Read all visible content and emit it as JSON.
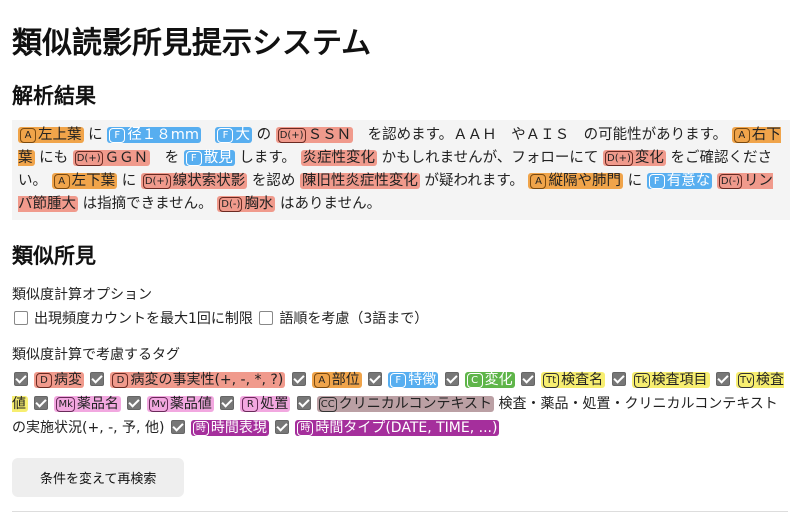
{
  "page": {
    "title": "類似読影所見提示システム",
    "section_results": "解析結果",
    "section_similar": "類似所見"
  },
  "result_segments": [
    {
      "t": "tag",
      "cls": "orange",
      "badge": "A",
      "text": "左上葉"
    },
    {
      "t": "text",
      "text": " に "
    },
    {
      "t": "tag",
      "cls": "blue",
      "badge": "F",
      "text": "径１８mm"
    },
    {
      "t": "text",
      "text": "　"
    },
    {
      "t": "tag",
      "cls": "blue",
      "badge": "F",
      "text": "大"
    },
    {
      "t": "text",
      "text": " の "
    },
    {
      "t": "tag",
      "cls": "red",
      "badge": "D(+)",
      "text": "ＳＳＮ"
    },
    {
      "t": "text",
      "text": "　を認めます。ＡＡＨ　やＡＩＳ　の可能性があります。 "
    },
    {
      "t": "tag",
      "cls": "orange",
      "badge": "A",
      "text": "右下葉"
    },
    {
      "t": "text",
      "text": " にも "
    },
    {
      "t": "tag",
      "cls": "red",
      "badge": "D(+)",
      "text": "ＧＧＮ"
    },
    {
      "t": "text",
      "text": "　を "
    },
    {
      "t": "tag",
      "cls": "blue",
      "badge": "F",
      "text": "散見"
    },
    {
      "t": "text",
      "text": " します。 "
    },
    {
      "t": "tag",
      "cls": "red",
      "badge": "",
      "text": "炎症性変化"
    },
    {
      "t": "text",
      "text": " かもしれませんが、フォローにて "
    },
    {
      "t": "tag",
      "cls": "red",
      "badge": "D(+)",
      "text": "変化"
    },
    {
      "t": "text",
      "text": " をご確認ください。 "
    },
    {
      "t": "tag",
      "cls": "orange",
      "badge": "A",
      "text": "左下葉"
    },
    {
      "t": "text",
      "text": " に "
    },
    {
      "t": "tag",
      "cls": "red",
      "badge": "D(+)",
      "text": "線状索状影"
    },
    {
      "t": "text",
      "text": " を認め "
    },
    {
      "t": "tag",
      "cls": "red",
      "badge": "",
      "text": "陳旧性炎症性変化"
    },
    {
      "t": "text",
      "text": " が疑われます。 "
    },
    {
      "t": "tag",
      "cls": "orange",
      "badge": "A",
      "text": "縦隔や肺門"
    },
    {
      "t": "text",
      "text": " に "
    },
    {
      "t": "tag",
      "cls": "blue",
      "badge": "F",
      "text": "有意な"
    },
    {
      "t": "text",
      "text": " "
    },
    {
      "t": "tag",
      "cls": "red",
      "badge": "D(-)",
      "text": "リンパ節腫大"
    },
    {
      "t": "text",
      "text": " は指摘できません。 "
    },
    {
      "t": "tag",
      "cls": "red",
      "badge": "D(-)",
      "text": "胸水"
    },
    {
      "t": "text",
      "text": " はありません。"
    }
  ],
  "options": {
    "label": "類似度計算オプション",
    "items": [
      {
        "label": "出現頻度カウントを最大1回に制限",
        "checked": false
      },
      {
        "label": "語順を考慮（3語まで）",
        "checked": false
      }
    ]
  },
  "tags": {
    "label": "類似度計算で考慮するタグ",
    "items": [
      {
        "cls": "red",
        "badge": "D",
        "label": "病変",
        "checked": true
      },
      {
        "cls": "red",
        "badge": "D",
        "label": "病変の事実性(+, -, *, ?)",
        "checked": true
      },
      {
        "cls": "orange",
        "badge": "A",
        "label": "部位",
        "checked": true
      },
      {
        "cls": "blue",
        "badge": "F",
        "label": "特徴",
        "checked": true
      },
      {
        "cls": "green",
        "badge": "C",
        "label": "変化",
        "checked": true
      },
      {
        "cls": "yellow",
        "badge": "Tt",
        "label": "検査名",
        "checked": true
      },
      {
        "cls": "yellow",
        "badge": "Tk",
        "label": "検査項目",
        "checked": true
      },
      {
        "cls": "yellow",
        "badge": "Tv",
        "label": "検査値",
        "checked": true
      },
      {
        "cls": "pink",
        "badge": "Mk",
        "label": "薬品名",
        "checked": true
      },
      {
        "cls": "pink",
        "badge": "Mv",
        "label": "薬品値",
        "checked": true
      },
      {
        "cls": "pink",
        "badge": "R",
        "label": "処置",
        "checked": true
      },
      {
        "cls": "mauve",
        "badge": "CC",
        "label": "クリニカルコンテキスト",
        "checked": true,
        "suffix": " 検査・薬品・処置・クリニカルコンテキストの実施状況(+, -, 予, 他)"
      },
      {
        "cls": "purple",
        "badge": "時",
        "label": "時間表現",
        "checked": true
      },
      {
        "cls": "purple",
        "badge": "時",
        "label": "時間タイプ(DATE, TIME, ...)",
        "checked": true
      }
    ]
  },
  "button": {
    "label": "条件を変えて再検索"
  }
}
